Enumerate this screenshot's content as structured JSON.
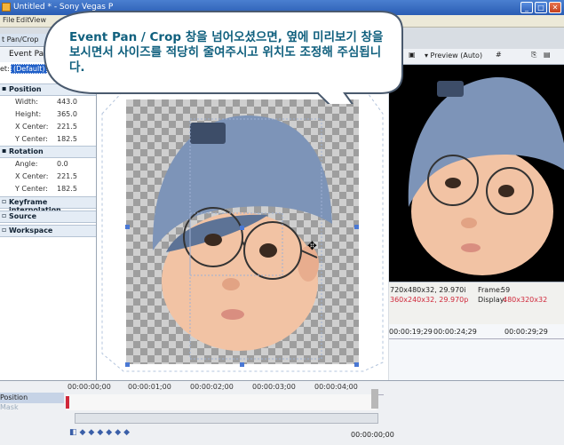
{
  "window": {
    "title": "Untitled * - Sony Vegas P",
    "min": "_",
    "max": "□",
    "close": "✕"
  },
  "menu": [
    "File",
    "Edit",
    "View"
  ],
  "panel": {
    "caption": "t Pan/Crop",
    "tab": "Event Pan/",
    "preset_label": "et:",
    "preset_value": "(Default)"
  },
  "sections": {
    "position": "Position",
    "rotation": "Rotation",
    "keyframe": "Keyframe interpolation",
    "source": "Source",
    "workspace": "Workspace"
  },
  "position_props": [
    {
      "k": "Width:",
      "v": "443.0"
    },
    {
      "k": "Height:",
      "v": "365.0"
    },
    {
      "k": "X Center:",
      "v": "221.5"
    },
    {
      "k": "Y Center:",
      "v": "182.5"
    }
  ],
  "rotation_props": [
    {
      "k": "Angle:",
      "v": "0.0"
    },
    {
      "k": "X Center:",
      "v": "221.5"
    },
    {
      "k": "Y Center:",
      "v": "182.5"
    }
  ],
  "bubble": {
    "text": "Event Pan / Crop 창을 넘어오셨으면, 옆에 미리보기 창을 보시면서 사이즈를 적당히 줄여주시고 위치도 조정해 주심됩니다."
  },
  "preview": {
    "mode": "▾ Preview (Auto)",
    "project": "720x480x32, 29.970i",
    "preview_res": "360x240x32, 29.970p",
    "frame_label": "Frame:",
    "frame_value": "59",
    "display_label": "Display:",
    "display_value": "480x320x32"
  },
  "timeline": {
    "marks_top": [
      "00:00:19;29",
      "00:00:24;29",
      "00:00:29;29"
    ],
    "ruler": [
      "00:00:00;00",
      "00:00:01;00",
      "00:00:02;00",
      "00:00:03;00",
      "00:00:04;00"
    ],
    "track_label": "Position",
    "track_sub": "Mask",
    "time_display": "00:00:00;00"
  },
  "colors": {
    "accent": "#1f5fc8",
    "bubble_text": "#10607e",
    "warn_red": "#d0283a"
  }
}
